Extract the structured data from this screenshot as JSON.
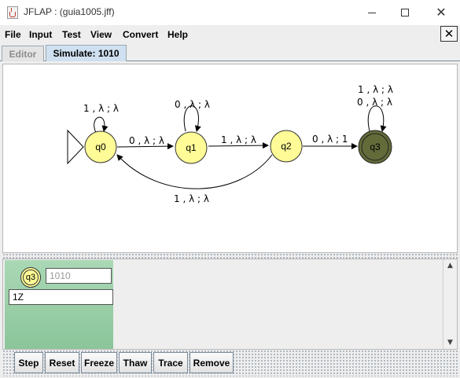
{
  "window": {
    "title": "JFLAP : (guia1005.jff)",
    "minimize_icon": "minimize-icon",
    "maximize_icon": "maximize-icon",
    "close_icon": "close-icon",
    "close_glyph": "✕"
  },
  "menubar": {
    "items": [
      "File",
      "Input",
      "Test",
      "View",
      "Convert",
      "Help"
    ],
    "close_glyph": "✕"
  },
  "tabs": [
    "Editor",
    "Simulate: 1010"
  ],
  "automaton": {
    "states": [
      "q0",
      "q1",
      "q2",
      "q3"
    ],
    "initial": "q0",
    "final": "q3",
    "current": "q3",
    "colors": {
      "state_fill": "#fffb96",
      "current_fill": "#636b3a",
      "stroke": "#333333"
    },
    "transitions": [
      {
        "from": "q0",
        "to": "q0",
        "label": "1 , λ ; λ"
      },
      {
        "from": "q0",
        "to": "q1",
        "label": "0 , λ ; λ"
      },
      {
        "from": "q1",
        "to": "q1",
        "label": "0 , λ ; λ"
      },
      {
        "from": "q1",
        "to": "q2",
        "label": "1 , λ ; λ"
      },
      {
        "from": "q2",
        "to": "q0",
        "label": "1 , λ ; λ"
      },
      {
        "from": "q2",
        "to": "q3",
        "label": "0 , λ ; 1"
      },
      {
        "from": "q3",
        "to": "q3",
        "label": "1 , λ ; λ"
      },
      {
        "from": "q3",
        "to": "q3",
        "label": "0 , λ ; λ"
      }
    ]
  },
  "simulation": {
    "config_state": "q3",
    "input": "1010",
    "stack": "1Z"
  },
  "buttons": [
    "Step",
    "Reset",
    "Freeze",
    "Thaw",
    "Trace",
    "Remove"
  ],
  "scroll": {
    "up": "▲",
    "down": "▼"
  }
}
